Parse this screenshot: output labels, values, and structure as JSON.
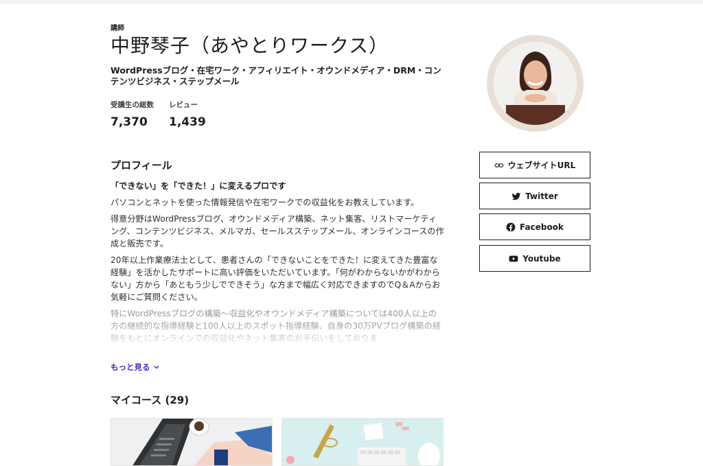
{
  "header": {
    "role": "講師",
    "name": "中野琴子（あやとりワークス）",
    "tagline": "WordPressブログ・在宅ワーク・アフィリエイト・オウンドメディア・DRM・コンテンツビジネス・ステップメール"
  },
  "stats": [
    {
      "label": "受講生の総数",
      "value": "7,370"
    },
    {
      "label": "レビュー",
      "value": "1,439"
    }
  ],
  "profile": {
    "title": "プロフィール",
    "lead": "「できない」を「できた！」に変えるプロです",
    "p1": "パソコンとネットを使った情報発信や在宅ワークでの収益化をお教えしています。",
    "p2": "得意分野はWordPressブログ、オウンドメディア構築、ネット集客、リストマーケティング、コンテンツビジネス、メルマガ、セールスステップメール、オンラインコースの作成と販売です。",
    "p3": "20年以上作業療法士として、患者さんの「できないことをできた！に変えてきた豊富な経験」を活かしたサポートに高い評価をいただいています。「何がわからないかがわからない」方から「あともう少しでできそう」な方まで幅広く対応できますのでQ＆Aからお気軽にご質問ください。",
    "p4": "特にWordPressブログの構築～収益化やオウンドメディア構築については400人以上の方の継続的な指導経験と100人以上のスポット指導経験、自身の30万PVブログ構築の経験をもとにオンラインでの収益化やネット集客のお手伝いをしておりま",
    "more": "もっと見る"
  },
  "courses": {
    "title": "マイコース (29)"
  },
  "links": {
    "website": "ウェブサイトURL",
    "twitter": "Twitter",
    "facebook": "Facebook",
    "youtube": "Youtube"
  },
  "colors": {
    "accent": "#5022c3",
    "avatar_ring": "#eadfd6",
    "text": "#1c1d1f"
  }
}
